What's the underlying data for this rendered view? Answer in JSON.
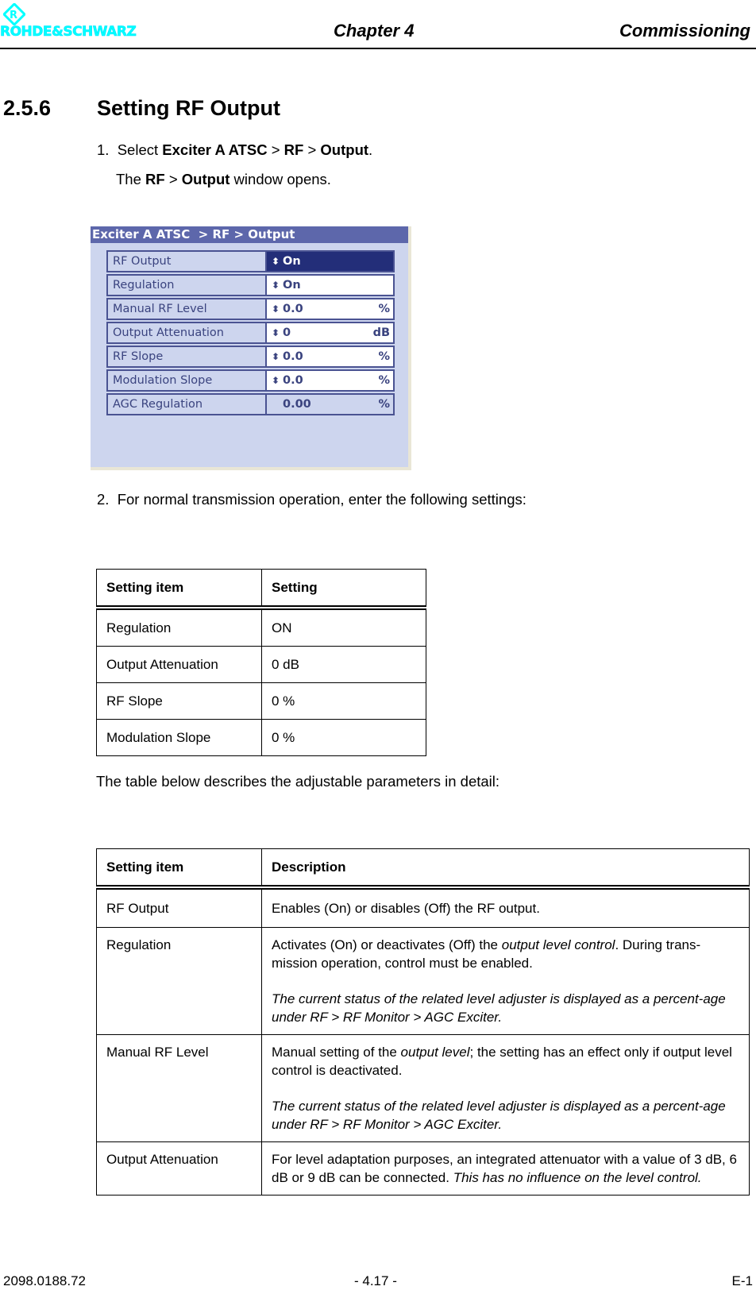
{
  "header": {
    "logo_text": "ROHDE&SCHWARZ",
    "chapter": "Chapter 4",
    "title": "Commissioning"
  },
  "section": {
    "number": "2.5.6",
    "title": "Setting RF Output"
  },
  "step1": {
    "num": "1.",
    "prefix": "Select ",
    "path_a": "Exciter A ATSC",
    "sep1": " > ",
    "path_b": "RF",
    "sep2": " > ",
    "path_c": "Output",
    "suffix": ".",
    "result_prefix": "The ",
    "result_a": "RF",
    "result_sep": " > ",
    "result_b": "Output",
    "result_suffix": " window opens."
  },
  "ui_panel": {
    "title": "Exciter A ATSC  > RF > Output",
    "rows": [
      {
        "label": "RF Output",
        "value": "On",
        "unit": "",
        "spinner": true,
        "state": "selected"
      },
      {
        "label": "Regulation",
        "value": "On",
        "unit": "",
        "spinner": true,
        "state": "normal"
      },
      {
        "label": "Manual RF Level",
        "value": "0.0",
        "unit": "%",
        "spinner": true,
        "state": "normal"
      },
      {
        "label": "Output Attenuation",
        "value": "0",
        "unit": "dB",
        "spinner": true,
        "state": "normal"
      },
      {
        "label": "RF Slope",
        "value": "0.0",
        "unit": "%",
        "spinner": true,
        "state": "normal"
      },
      {
        "label": "Modulation Slope",
        "value": "0.0",
        "unit": "%",
        "spinner": true,
        "state": "normal"
      },
      {
        "label": "AGC Regulation",
        "value": "0.00",
        "unit": "%",
        "spinner": false,
        "state": "readonly"
      }
    ],
    "colors": {
      "title_bg": "#5d67ab",
      "panel_bg": "#cdd5ee",
      "selected_bg": "#232e79",
      "border": "#4a5392",
      "text": "#3a437f"
    }
  },
  "step2": {
    "num": "2.",
    "text": "For normal transmission operation, enter the following settings:"
  },
  "settings_table": {
    "headers": [
      "Setting item",
      "Setting"
    ],
    "rows": [
      [
        "Regulation",
        "ON"
      ],
      [
        "Output Attenuation",
        "0 dB"
      ],
      [
        "RF Slope",
        "0 %"
      ],
      [
        "Modulation Slope",
        "0 %"
      ]
    ]
  },
  "intro2": "The table below describes the adjustable parameters in detail:",
  "desc_table": {
    "headers": [
      "Setting item",
      "Description"
    ],
    "rows": [
      {
        "item": "RF Output",
        "p1": "Enables (On) or disables (Off) the RF output."
      },
      {
        "item": "Regulation",
        "p1_a": "Activates (On) or deactivates (Off) the ",
        "p1_em": "output level control",
        "p1_b": ". During trans-mission operation, control must be enabled.",
        "p2_em": "The current status of the related level adjuster is displayed as a percent-age under RF > RF Monitor > AGC Exciter."
      },
      {
        "item": "Manual RF Level",
        "p1_a": "Manual setting of the ",
        "p1_em": "output level",
        "p1_b": "; the setting has an effect only if output level control is deactivated.",
        "p2_em": "The current status of the related level adjuster is displayed as a percent-age under RF > RF Monitor > AGC Exciter."
      },
      {
        "item": "Output Attenuation",
        "p1_a": "For level adaptation purposes, an integrated attenuator with a value of 3 dB, 6 dB or 9 dB can be connected. ",
        "p1_em": "This has no influence on the level control."
      }
    ]
  },
  "footer": {
    "doc_number": "2098.0188.72",
    "page": "- 4.17 -",
    "edition": "E-1"
  }
}
